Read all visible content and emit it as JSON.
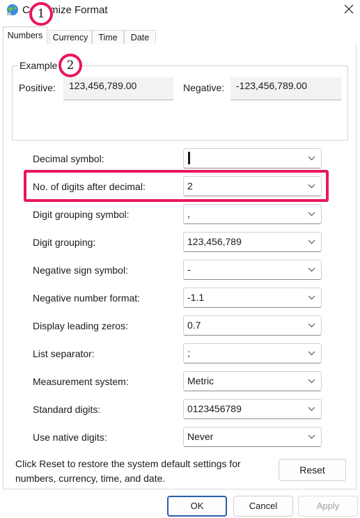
{
  "window": {
    "title": "Customize Format"
  },
  "tabs": [
    {
      "label": "Numbers"
    },
    {
      "label": "Currency"
    },
    {
      "label": "Time"
    },
    {
      "label": "Date"
    }
  ],
  "example": {
    "legend": "Example",
    "positive_label": "Positive:",
    "positive_value": "123,456,789.00",
    "negative_label": "Negative:",
    "negative_value": "-123,456,789.00"
  },
  "settings": [
    {
      "label": "Decimal symbol:",
      "value": "."
    },
    {
      "label": "No. of digits after decimal:",
      "value": "2"
    },
    {
      "label": "Digit grouping symbol:",
      "value": ","
    },
    {
      "label": "Digit grouping:",
      "value": "123,456,789"
    },
    {
      "label": "Negative sign symbol:",
      "value": "-"
    },
    {
      "label": "Negative number format:",
      "value": "-1.1"
    },
    {
      "label": "Display leading zeros:",
      "value": "0.7"
    },
    {
      "label": "List separator:",
      "value": ";"
    },
    {
      "label": "Measurement system:",
      "value": "Metric"
    },
    {
      "label": "Standard digits:",
      "value": "0123456789"
    },
    {
      "label": "Use native digits:",
      "value": "Never"
    }
  ],
  "annotations": {
    "marker_1": "1",
    "marker_2": "2",
    "highlight_color": "#e8175d"
  },
  "footer": {
    "info": "Click Reset to restore the system default settings for numbers, currency, time, and date.",
    "reset_label": "Reset",
    "ok_label": "OK",
    "cancel_label": "Cancel",
    "apply_label": "Apply"
  }
}
